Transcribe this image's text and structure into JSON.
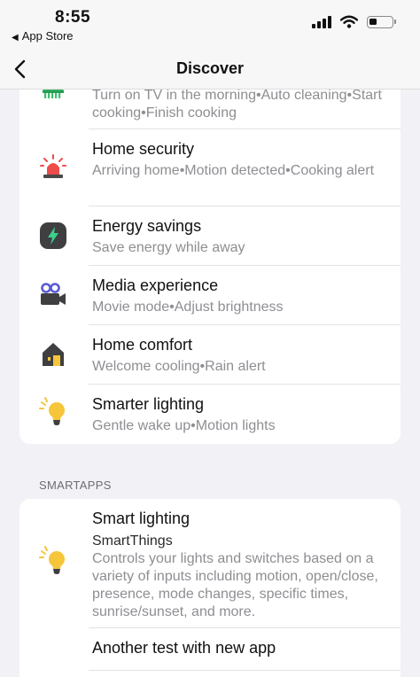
{
  "status_bar": {
    "time": "8:55",
    "back_app": "App Store",
    "back_arrow": "◀"
  },
  "nav": {
    "title": "Discover",
    "back_icon": "chevron-left-icon"
  },
  "discover_items": [
    {
      "icon": "cleaning-robot-icon",
      "title": "",
      "subtitle": "Turn on TV in the morning•Auto cleaning•Start cooking•Finish cooking"
    },
    {
      "icon": "siren-icon",
      "title": "Home security",
      "subtitle": "Arriving home•Motion detected•Cooking alert"
    },
    {
      "icon": "energy-bolt-icon",
      "title": "Energy savings",
      "subtitle": "Save energy while away"
    },
    {
      "icon": "video-camera-icon",
      "title": "Media experience",
      "subtitle": "Movie mode•Adjust brightness"
    },
    {
      "icon": "house-icon",
      "title": "Home comfort",
      "subtitle": "Welcome cooling•Rain alert"
    },
    {
      "icon": "light-bulb-icon",
      "title": "Smarter lighting",
      "subtitle": "Gentle wake up•Motion lights"
    }
  ],
  "smartapps": {
    "header": "SMARTAPPS",
    "items": [
      {
        "icon": "light-bulb-icon",
        "title": "Smart lighting",
        "organization": "SmartThings",
        "description": "Controls your lights and switches based on a variety of inputs including motion, open/close, presence, mode changes, specific times, sunrise/sunset, and more."
      },
      {
        "title": "Another test with new app"
      }
    ]
  },
  "colors": {
    "background": "#f2f2f6",
    "card": "#ffffff",
    "subtitle": "#8e8e93",
    "siren_red": "#ee4b4b",
    "bulb_yellow": "#f5c53a",
    "energy_green": "#3ad08a",
    "camera_purple": "#5b5bd6",
    "robot_green": "#3bbf6b"
  }
}
